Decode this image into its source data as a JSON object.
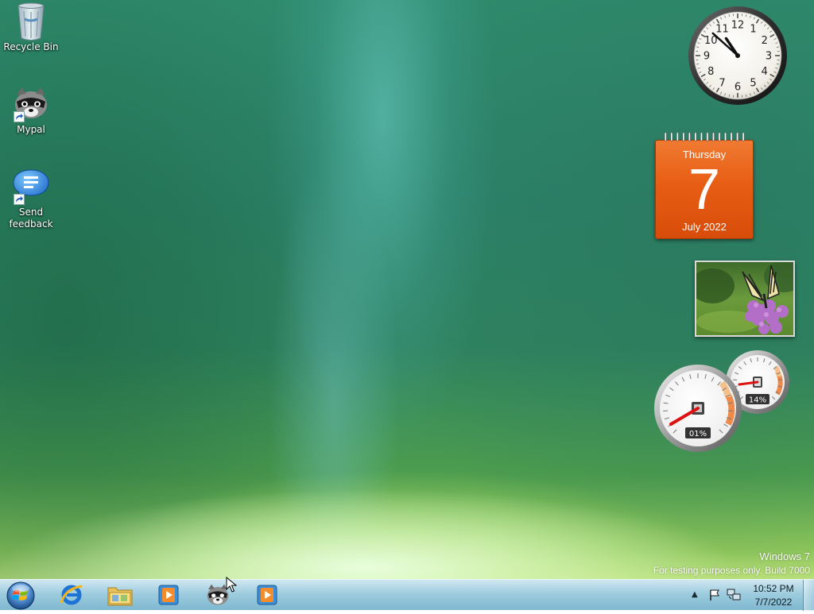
{
  "desktop": {
    "icons": [
      {
        "label": "Recycle Bin",
        "icon": "recycle-bin-icon"
      },
      {
        "label": "Mypal",
        "icon": "mypal-raccoon-icon"
      },
      {
        "label_line1": "Send",
        "label_line2": "feedback",
        "icon": "send-feedback-icon"
      }
    ]
  },
  "gadgets": {
    "clock": {
      "hour": 10,
      "minute": 52
    },
    "calendar": {
      "day_of_week": "Thursday",
      "day": "7",
      "month_year": "July 2022",
      "color": "#e85d14"
    },
    "slideshow": {
      "subject": "butterfly-photo"
    },
    "cpu_meter": {
      "cpu_percent": "01%",
      "memory_percent": "14%"
    }
  },
  "watermark": {
    "line1": "Windows 7",
    "line2": "For testing purposes only. Build 7000"
  },
  "taskbar": {
    "start_icon": "windows-orb-icon",
    "pinned": [
      {
        "name": "internet-explorer-icon"
      },
      {
        "name": "windows-explorer-icon"
      },
      {
        "name": "media-player-icon"
      },
      {
        "name": "mypal-raccoon-icon"
      },
      {
        "name": "media-player-icon"
      }
    ],
    "tray": {
      "time": "10:52 PM",
      "date": "7/7/2022"
    }
  }
}
